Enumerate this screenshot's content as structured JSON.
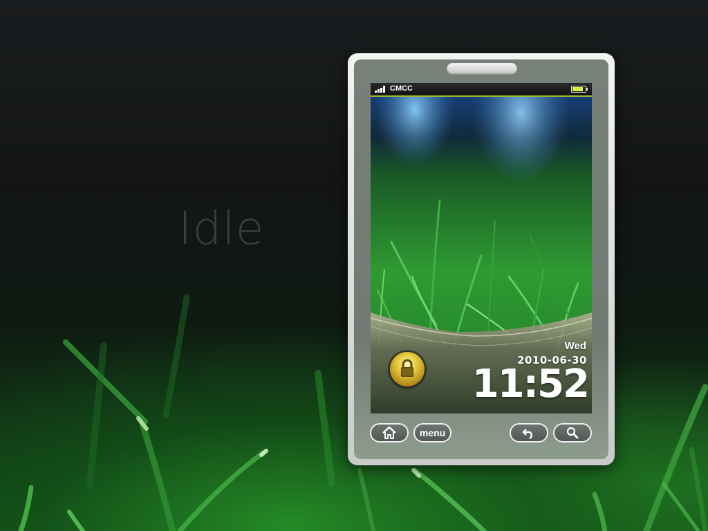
{
  "background": {
    "label": "Idle"
  },
  "phone": {
    "status_bar": {
      "carrier": "CMCC",
      "signal_icon": "signal-bars-icon",
      "battery_icon": "battery-icon"
    },
    "lock_screen": {
      "day": "Wed",
      "date": "2010-06-30",
      "time": "11:52",
      "lock_icon": "padlock-icon"
    },
    "buttons": {
      "home_icon": "home-icon",
      "menu_label": "menu",
      "back_icon": "back-arrow-icon",
      "search_icon": "search-icon"
    }
  },
  "colors": {
    "accent": "#9bbf2a",
    "lock_gold": "#e6c83a",
    "grass_green": "#2f9a2f"
  }
}
